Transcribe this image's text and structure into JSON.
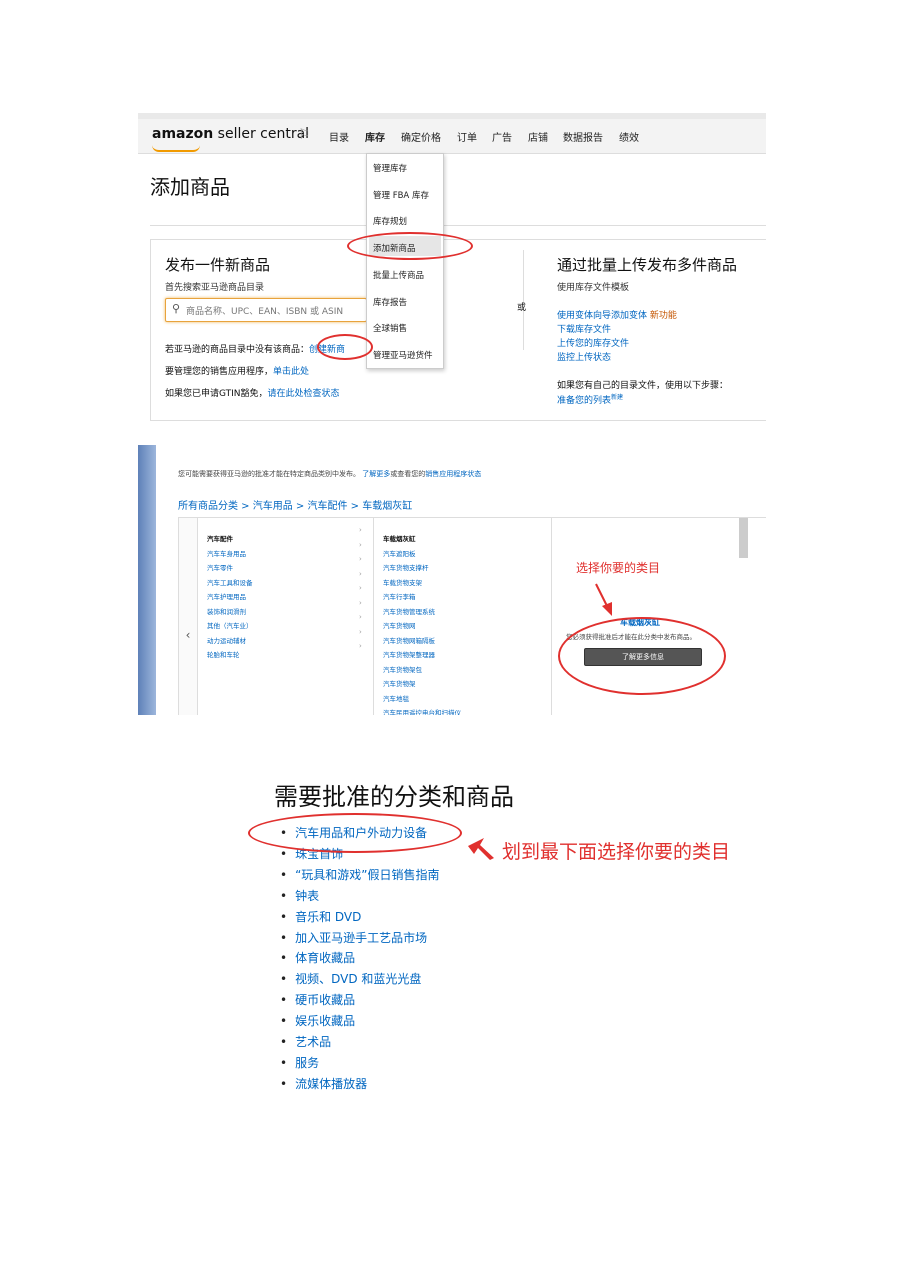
{
  "screenshot1": {
    "logo": {
      "amazon": "amazon",
      "rest": " seller central"
    },
    "nav": [
      "目录",
      "库存",
      "确定价格",
      "订单",
      "广告",
      "店铺",
      "数据报告",
      "绩效"
    ],
    "page_title": "添加商品",
    "publish": {
      "title": "发布一件新商品",
      "subtitle": "首先搜索亚马逊商品目录",
      "search_placeholder": "商品名称、UPC、EAN、ISBN 或 ASIN",
      "line1_text": "若亚马逊的商品目录中没有该商品：",
      "line1_link": "创建新商",
      "line2_text": "要管理您的销售应用程序，",
      "line2_link": "单击此处",
      "line3_text": "如果您已申请GTIN豁免，",
      "line3_link": "请在此处检查状态"
    },
    "or_label": "或",
    "bulk": {
      "title": "通过批量上传发布多件商品",
      "subtitle": "使用库存文件模板",
      "link1": "使用变体向导添加变体",
      "link1_badge": "新功能",
      "link2": "下载库存文件",
      "link3": "上传您的库存文件",
      "link4": "监控上传状态",
      "own_catalog_text": "如果您有自己的目录文件，使用以下步骤：",
      "prepare_link": "准备您的列表",
      "prepare_badge": "新建"
    },
    "dropdown": [
      "管理库存",
      "管理 FBA 库存",
      "库存规划",
      "添加新商品",
      "批量上传商品",
      "库存报告",
      "全球销售",
      "管理亚马逊货件"
    ]
  },
  "screenshot2": {
    "notice": "您可能需要获得亚马逊的批准才能在特定商品类别中发布。",
    "notice_link": "了解更多",
    "notice_mid": "或查看您的",
    "notice_link2": "销售应用程序状态",
    "breadcrumb": "所有商品分类 > 汽车用品 > 汽车配件 > 车载烟灰缸",
    "col1": [
      "汽车配件",
      "汽车车身用品",
      "汽车零件",
      "汽车工具和设备",
      "汽车护理用品",
      "装饰和润滑剂",
      "其他（汽车业）",
      "动力运动辅材",
      "轮胎和车轮"
    ],
    "col2": [
      "车载烟灰缸",
      "汽车遮阳板",
      "汽车货物支撑杆",
      "车载货物支架",
      "汽车行李箱",
      "汽车货物管理系统",
      "汽车货物网",
      "汽车货物网箱隔板",
      "汽车货物架整理器",
      "汽车货物架包",
      "汽车货物架",
      "汽车地毯",
      "汽车民用遥控电台和扫描仪"
    ],
    "detail_title": "车载烟灰缸",
    "detail_text": "您必须获得批准后才能在此分类中发布商品。",
    "learn_more": "了解更多信息",
    "annotation": "选择你要的类目",
    "arrow_left": "‹",
    "arrow_right": "›"
  },
  "section3": {
    "title": "需要批准的分类和商品",
    "items": [
      "汽车用品和户外动力设备",
      "珠宝首饰",
      "“玩具和游戏”假日销售指南",
      "钟表",
      "音乐和 DVD",
      "加入亚马逊手工艺品市场",
      "体育收藏品",
      "视频、DVD 和蓝光光盘",
      "硬币收藏品",
      "娱乐收藏品",
      "艺术品",
      "服务",
      "流媒体播放器"
    ],
    "annotation": "划到最下面选择你要的类目"
  },
  "colors": {
    "link": "#0066c0",
    "annotation_red": "#e0302e",
    "search_focus": "#e8a33c"
  },
  "icons": [
    "flag-icon",
    "search-icon",
    "red-arrow-icon"
  ]
}
